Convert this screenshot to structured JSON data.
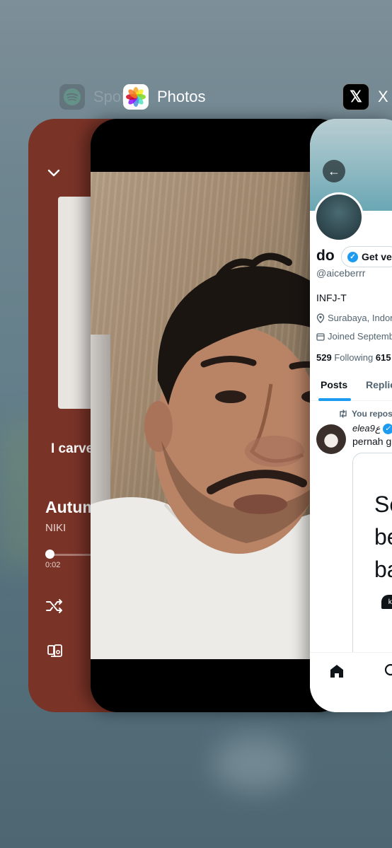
{
  "app_switcher": {
    "apps": [
      {
        "name": "Spotify",
        "icon": "spotify-icon"
      },
      {
        "name": "Photos",
        "icon": "photos-icon"
      },
      {
        "name": "X",
        "icon": "x-logo-icon"
      }
    ]
  },
  "spotify_card": {
    "lyric_line": "I carve",
    "song_title": "Autum",
    "artist": "NIKI",
    "elapsed_time": "0:02",
    "background_color": "#7a3327"
  },
  "photos_card": {
    "content": "selfie-photo"
  },
  "x_card": {
    "display_name": "do",
    "get_verified_label": "Get ve",
    "handle": "@aiceberrr",
    "bio": "INFJ-T",
    "location": "Surabaya, Indon",
    "joined": "Joined Septemb",
    "following_count": "529",
    "following_label": "Following",
    "followers_count": "615",
    "tabs": [
      "Posts",
      "Replie"
    ],
    "repost_label": "You repos",
    "post_author": "elea9ع",
    "post_text": "pernah g",
    "embed_lines": [
      "Se",
      "be",
      "ba"
    ],
    "embed_chip": "ka",
    "accent_color": "#1d9bf0"
  }
}
